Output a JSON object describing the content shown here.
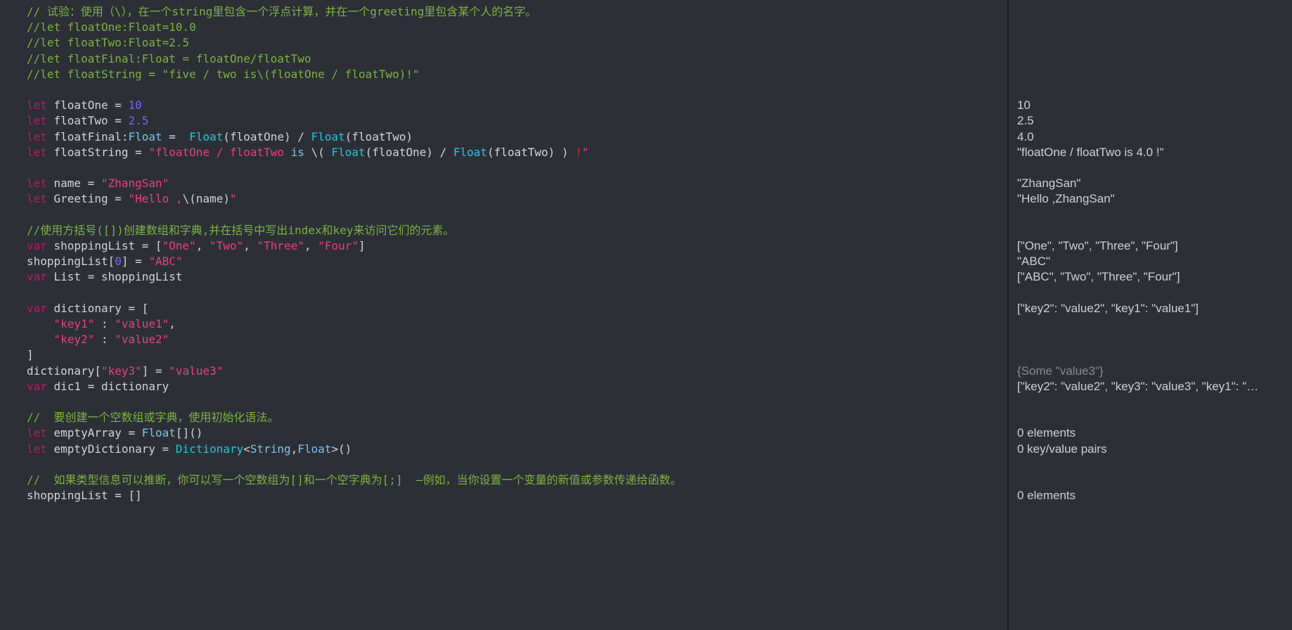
{
  "code": {
    "l1": "// 试验：使用（\\），在一个string里包含一个浮点计算，并在一个greeting里包含某个人的名字。",
    "l2": "//let floatOne:Float=10.0",
    "l3": "//let floatTwo:Float=2.5",
    "l4": "//let floatFinal:Float = floatOne/floatTwo",
    "l5": "//let floatString = \"five / two is\\(floatOne / floatTwo)!\"",
    "l6_let": "let ",
    "l6_id": "floatOne = ",
    "l6_num": "10",
    "l7_let": "let ",
    "l7_id": "floatTwo = ",
    "l7_num": "2.5",
    "l8_let": "let ",
    "l8_id": "floatFinal:",
    "l8_type": "Float",
    "l8_eq": " =  ",
    "l8_fn1": "Float",
    "l8_p1": "(floatOne) / ",
    "l8_fn2": "Float",
    "l8_p2": "(floatTwo)",
    "l9_let": "let ",
    "l9_id": "floatString = ",
    "l9_str1": "\"floatOne / floatTwo ",
    "l9_is": "is",
    "l9_str2": " \\(",
    "l9_fn1": " Float",
    "l9_p1": "(floatOne) / ",
    "l9_fn2": "Float",
    "l9_p2": "(floatTwo) ",
    "l9_str3": ") ",
    "l9_bang": "!",
    "l9_end": "\"",
    "l10_let": "let ",
    "l10_id": "name = ",
    "l10_str": "\"ZhangSan\"",
    "l11_let": "let ",
    "l11_id": "Greeting = ",
    "l11_str1": "\"Hello ,",
    "l11_interp": "\\(",
    "l11_name": "name",
    "l11_close": ")",
    "l11_end": "\"",
    "l12": "//使用方括号([])创建数组和字典,并在括号中写出index和key来访问它们的元素。",
    "l13_var": "var ",
    "l13_id": "shoppingList = [",
    "l13_s1": "\"One\"",
    "l13_c": ", ",
    "l13_s2": "\"Two\"",
    "l13_s3": "\"Three\"",
    "l13_s4": "\"Four\"",
    "l13_end": "]",
    "l14_a": "shoppingList[",
    "l14_idx": "0",
    "l14_b": "] = ",
    "l14_str": "\"ABC\"",
    "l15_var": "var ",
    "l15_id": "List = shoppingList",
    "l16_var": "var ",
    "l16_id": "dictionary = [",
    "l17_k": "    \"key1\"",
    "l17_sep": " : ",
    "l17_v": "\"value1\"",
    "l17_c": ",",
    "l18_k": "    \"key2\"",
    "l18_sep": " : ",
    "l18_v": "\"value2\"",
    "l19": "]",
    "l20_a": "dictionary[",
    "l20_k": "\"key3\"",
    "l20_b": "] = ",
    "l20_v": "\"value3\"",
    "l21_var": "var ",
    "l21_id": "dic1 = dictionary",
    "l22": "//  要创建一个空数组或字典，使用初始化语法。",
    "l23_let": "let ",
    "l23_id": "emptyArray = ",
    "l23_type": "Float",
    "l23_end": "[]()",
    "l24_let": "let ",
    "l24_id": "emptyDictionary = ",
    "l24_dict": "Dictionary",
    "l24_lt": "<",
    "l24_t1": "String",
    "l24_c": ",",
    "l24_t2": "Float",
    "l24_gt": ">()",
    "l25": "//  如果类型信息可以推断，你可以写一个空数组为[]和一个空字典为[;]  —例如，当你设置一个变量的新值或参数传递给函数。",
    "l26": "shoppingList = []"
  },
  "results": {
    "r1": "10",
    "r2": "2.5",
    "r3": "4.0",
    "r4": "\"floatOne / floatTwo is 4.0 !\"",
    "r5": "\"ZhangSan\"",
    "r6": "\"Hello ,ZhangSan\"",
    "r7": "[\"One\", \"Two\", \"Three\", \"Four\"]",
    "r8": "\"ABC\"",
    "r9": "[\"ABC\", \"Two\", \"Three\", \"Four\"]",
    "r10": "[\"key2\": \"value2\", \"key1\": \"value1\"]",
    "r11": "{Some \"value3\"}",
    "r12": "[\"key2\": \"value2\", \"key3\": \"value3\", \"key1\": \"…",
    "r13": "0 elements",
    "r14": "0 key/value pairs",
    "r15": "0 elements"
  }
}
